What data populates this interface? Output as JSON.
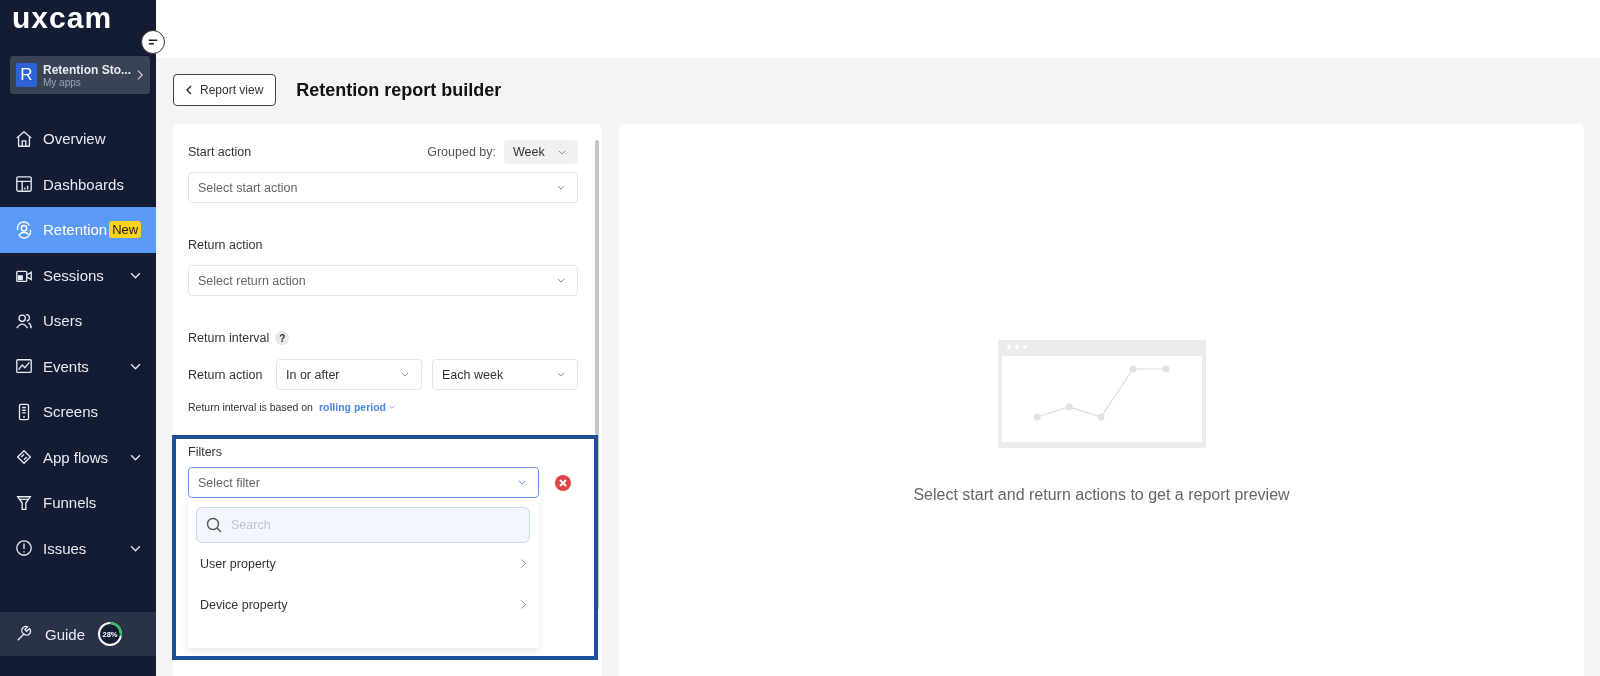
{
  "logo": {
    "text": "uxcam"
  },
  "app_switcher": {
    "initial": "R",
    "name": "Retention Sto...",
    "subtitle": "My apps"
  },
  "nav": [
    {
      "label": "Overview",
      "selected": false,
      "expandable": false
    },
    {
      "label": "Dashboards",
      "selected": false,
      "expandable": false
    },
    {
      "label": "Retention",
      "selected": true,
      "expandable": false,
      "badge": "New"
    },
    {
      "label": "Sessions",
      "selected": false,
      "expandable": true
    },
    {
      "label": "Users",
      "selected": false,
      "expandable": false
    },
    {
      "label": "Events",
      "selected": false,
      "expandable": true
    },
    {
      "label": "Screens",
      "selected": false,
      "expandable": false
    },
    {
      "label": "App flows",
      "selected": false,
      "expandable": true
    },
    {
      "label": "Funnels",
      "selected": false,
      "expandable": false
    },
    {
      "label": "Issues",
      "selected": false,
      "expandable": true
    }
  ],
  "guide": {
    "label": "Guide",
    "progress": "28%",
    "level": 0.28
  },
  "back_button": "Report view",
  "page_title": "Retention report builder",
  "start_action": {
    "label": "Start action",
    "grouped_by_label": "Grouped by:",
    "grouped_by_value": "Week",
    "placeholder": "Select start action"
  },
  "return_action": {
    "label": "Return action",
    "placeholder": "Select return action"
  },
  "return_interval": {
    "label": "Return interval",
    "help": "?",
    "row_label": "Return action",
    "condition": "In or after",
    "period": "Each week",
    "note": "Return interval is based on",
    "note_link": "rolling period"
  },
  "filters": {
    "label": "Filters",
    "placeholder": "Select filter",
    "search_placeholder": "Search",
    "options": [
      "User property",
      "Device property"
    ]
  },
  "preview": {
    "message": "Select start and return actions to get a report preview"
  }
}
